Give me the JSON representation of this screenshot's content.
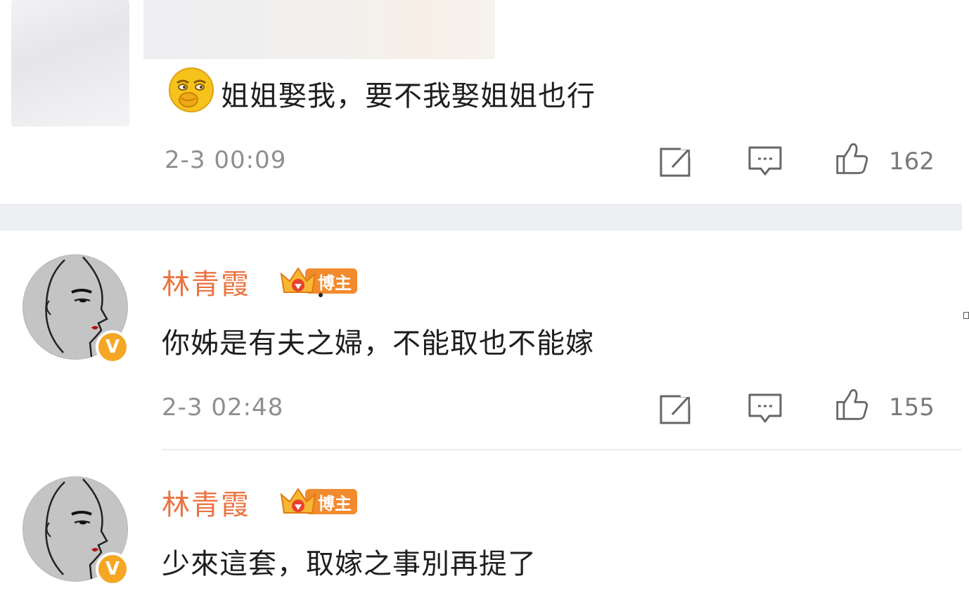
{
  "comments": [
    {
      "text": "姐姐娶我，要不我娶姐姐也行",
      "emoji": "smirk-face-emoji",
      "time": "2-3 00:09",
      "likes": "162"
    },
    {
      "username": "林青霞",
      "badge_label": "博主",
      "text": "你姊是有夫之婦，不能取也不能嫁",
      "time": "2-3 02:48",
      "likes": "155",
      "verified": "V"
    },
    {
      "username": "林青霞",
      "badge_label": "博主",
      "text": "少來這套，取嫁之事別再提了",
      "verified": "V"
    }
  ],
  "icons": {
    "repost": "repost-icon",
    "comment": "comment-icon",
    "like": "thumbs-up-icon"
  },
  "colors": {
    "username": "#eb7340",
    "badge": "#f28a2e",
    "verified": "#f5a623",
    "meta": "#8f8f8f",
    "separator": "#eceef2"
  }
}
